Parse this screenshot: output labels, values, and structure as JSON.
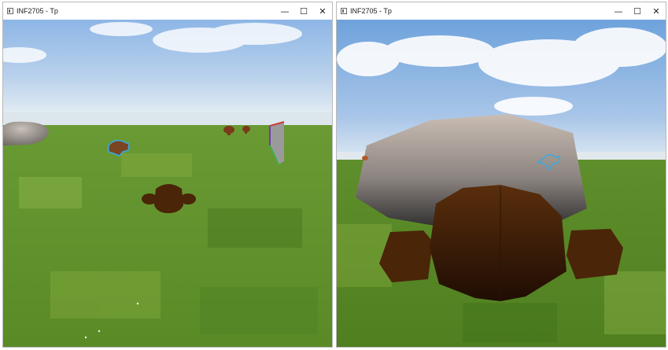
{
  "windows": [
    {
      "title": "INF2705 - Tp",
      "controls": {
        "minimize": "—",
        "maximize": "☐",
        "close": "✕"
      },
      "view": "third-person"
    },
    {
      "title": "INF2705 - Tp",
      "controls": {
        "minimize": "—",
        "maximize": "☐",
        "close": "✕"
      },
      "view": "close-up"
    }
  ],
  "colors": {
    "sky_top": "#8fb8e6",
    "sky_horizon": "#dfe9f2",
    "grass_dark": "#3f7a1e",
    "grass_light": "#8fb346",
    "monkey": "#4a2508",
    "rock_top": "#bdb3ab",
    "rock_bottom": "#2d2d2d",
    "selection_outline": "#39a9e6"
  }
}
